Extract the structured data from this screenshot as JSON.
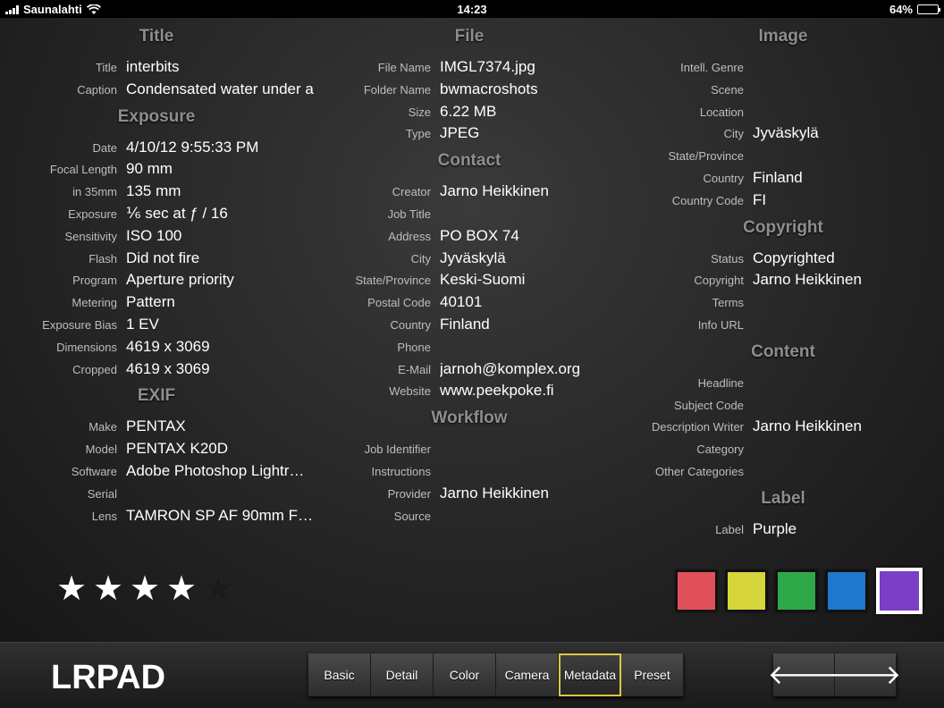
{
  "status": {
    "carrier": "Saunalahti",
    "time": "14:23",
    "battery": "64%",
    "battery_level": 0.64
  },
  "columns": {
    "left": [
      {
        "title": "Title",
        "rows": [
          {
            "label": "Title",
            "value": "interbits"
          },
          {
            "label": "Caption",
            "value": "Condensated water under a"
          }
        ]
      },
      {
        "title": "Exposure",
        "rows": [
          {
            "label": "Date",
            "value": "4/10/12 9:55:33 PM"
          },
          {
            "label": "Focal Length",
            "value": "90 mm"
          },
          {
            "label": "in 35mm",
            "value": "135 mm"
          },
          {
            "label": "Exposure",
            "value": "⅙ sec at ƒ / 16"
          },
          {
            "label": "Sensitivity",
            "value": "ISO 100"
          },
          {
            "label": "Flash",
            "value": "Did not fire"
          },
          {
            "label": "Program",
            "value": "Aperture priority"
          },
          {
            "label": "Metering",
            "value": "Pattern"
          },
          {
            "label": "Exposure Bias",
            "value": "1 EV"
          },
          {
            "label": "Dimensions",
            "value": "4619 x 3069"
          },
          {
            "label": "Cropped",
            "value": "4619 x 3069"
          }
        ]
      },
      {
        "title": "EXIF",
        "rows": [
          {
            "label": "Make",
            "value": "PENTAX"
          },
          {
            "label": "Model",
            "value": "PENTAX K20D"
          },
          {
            "label": "Software",
            "value": "Adobe Photoshop Lightr…"
          },
          {
            "label": "Serial",
            "value": ""
          },
          {
            "label": "Lens",
            "value": "TAMRON SP AF 90mm F…"
          }
        ]
      }
    ],
    "middle": [
      {
        "title": "File",
        "rows": [
          {
            "label": "File Name",
            "value": "IMGL7374.jpg"
          },
          {
            "label": "Folder Name",
            "value": "bwmacroshots"
          },
          {
            "label": "Size",
            "value": "6.22 MB"
          },
          {
            "label": "Type",
            "value": "JPEG"
          }
        ]
      },
      {
        "title": "Contact",
        "rows": [
          {
            "label": "Creator",
            "value": "Jarno Heikkinen"
          },
          {
            "label": "Job Title",
            "value": ""
          },
          {
            "label": "Address",
            "value": "PO BOX 74"
          },
          {
            "label": "City",
            "value": "Jyväskylä"
          },
          {
            "label": "State/Province",
            "value": "Keski-Suomi"
          },
          {
            "label": "Postal Code",
            "value": "40101"
          },
          {
            "label": "Country",
            "value": "Finland"
          },
          {
            "label": "Phone",
            "value": ""
          },
          {
            "label": "E-Mail",
            "value": "jarnoh@komplex.org"
          },
          {
            "label": "Website",
            "value": "www.peekpoke.fi"
          }
        ]
      },
      {
        "title": "Workflow",
        "rows": [
          {
            "label": "Job Identifier",
            "value": ""
          },
          {
            "label": "Instructions",
            "value": ""
          },
          {
            "label": "Provider",
            "value": "Jarno Heikkinen"
          },
          {
            "label": "Source",
            "value": ""
          }
        ]
      }
    ],
    "right": [
      {
        "title": "Image",
        "rows": [
          {
            "label": "Intell. Genre",
            "value": ""
          },
          {
            "label": "Scene",
            "value": ""
          },
          {
            "label": "Location",
            "value": ""
          },
          {
            "label": "City",
            "value": "Jyväskylä"
          },
          {
            "label": "State/Province",
            "value": ""
          },
          {
            "label": "Country",
            "value": "Finland"
          },
          {
            "label": "Country Code",
            "value": "FI"
          }
        ]
      },
      {
        "title": "Copyright",
        "rows": [
          {
            "label": "Status",
            "value": "Copyrighted"
          },
          {
            "label": "Copyright",
            "value": "Jarno Heikkinen"
          },
          {
            "label": "Terms",
            "value": ""
          },
          {
            "label": "Info URL",
            "value": ""
          }
        ]
      },
      {
        "title": "Content",
        "rows": [
          {
            "label": "Headline",
            "value": ""
          },
          {
            "label": "Subject Code",
            "value": ""
          },
          {
            "label": "Description Writer",
            "value": "Jarno Heikkinen"
          },
          {
            "label": "Category",
            "value": ""
          },
          {
            "label": "Other Categories",
            "value": ""
          }
        ]
      },
      {
        "title": "Label",
        "rows": [
          {
            "label": "Label",
            "value": "Purple"
          }
        ]
      }
    ]
  },
  "rating": {
    "stars": 4,
    "max": 5,
    "star_glyph": "★"
  },
  "color_labels": [
    {
      "name": "red",
      "color": "#e0505a"
    },
    {
      "name": "yellow",
      "color": "#d6d63a"
    },
    {
      "name": "green",
      "color": "#2fa84a"
    },
    {
      "name": "blue",
      "color": "#1e78cc"
    },
    {
      "name": "purple",
      "color": "#7a3fc4",
      "selected": true
    }
  ],
  "toolbar": {
    "logo": "LRPAD",
    "tabs": [
      {
        "label": "Basic"
      },
      {
        "label": "Detail"
      },
      {
        "label": "Color"
      },
      {
        "label": "Camera"
      },
      {
        "label": "Metadata",
        "active": true
      },
      {
        "label": "Preset"
      }
    ],
    "prev_glyph": "🡐",
    "next_glyph": "🡒"
  }
}
